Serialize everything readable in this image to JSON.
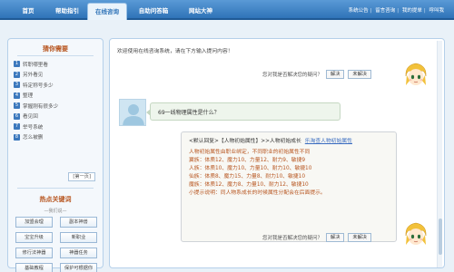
{
  "nav": {
    "tabs": [
      {
        "label": "首页",
        "active": false
      },
      {
        "label": "帮助指引",
        "active": false
      },
      {
        "label": "在线咨询",
        "active": true
      },
      {
        "label": "自助问答箱",
        "active": false
      },
      {
        "label": "网站大神",
        "active": false
      }
    ],
    "links": [
      "系统公告",
      "留言咨询",
      "我的提单",
      "呼叫我"
    ]
  },
  "sidebar": {
    "title": "猜你需要",
    "questions": [
      {
        "num": "1",
        "text": "转职哪里看"
      },
      {
        "num": "2",
        "text": "另外看见"
      },
      {
        "num": "3",
        "text": "特定称号多少"
      },
      {
        "num": "4",
        "text": "整理"
      },
      {
        "num": "5",
        "text": "掌握刚有很多少"
      },
      {
        "num": "6",
        "text": "看见回"
      },
      {
        "num": "7",
        "text": "举号系统"
      },
      {
        "num": "8",
        "text": "怎么被删"
      }
    ],
    "page_button": "[第一页]",
    "hot_title": "热点关键词",
    "hot_subtitle": "—我们说—",
    "keywords": [
      "加盟会理",
      "副本神兽",
      "宝宝升级",
      "新职业",
      "修行法神器",
      "神器任务",
      "基础教程",
      "保护可根据你"
    ]
  },
  "chat": {
    "welcome": "欢迎使用在线咨询系统，请在下方输入提问内容！",
    "feedback_prompt": "您对我是否解决您的疑问？",
    "feedback_solved": "解决",
    "feedback_unsolved": "未解决",
    "user_question": "69一线物理属性是什么？",
    "answer": {
      "head": "<默认回复>【人物初始属性】>>人物初始成长",
      "link": "乐淘查人物初始属性",
      "lines": [
        "人物初始属性由职业绑定，不同职业的初始属性不同",
        "翼族：体质12、魔力10、力量12、耐力9、敏捷9",
        "人族：体质10、魔力10、力量10、耐力10、敏捷10",
        "仙族：体质8、魔力15、力量8、耐力10、敏捷10",
        "魔族：体质12、魔力8、力量10、耐力12、敏捷10",
        "小提示说明：同人物系成长的时候属性分配会在后面提示。"
      ]
    }
  }
}
